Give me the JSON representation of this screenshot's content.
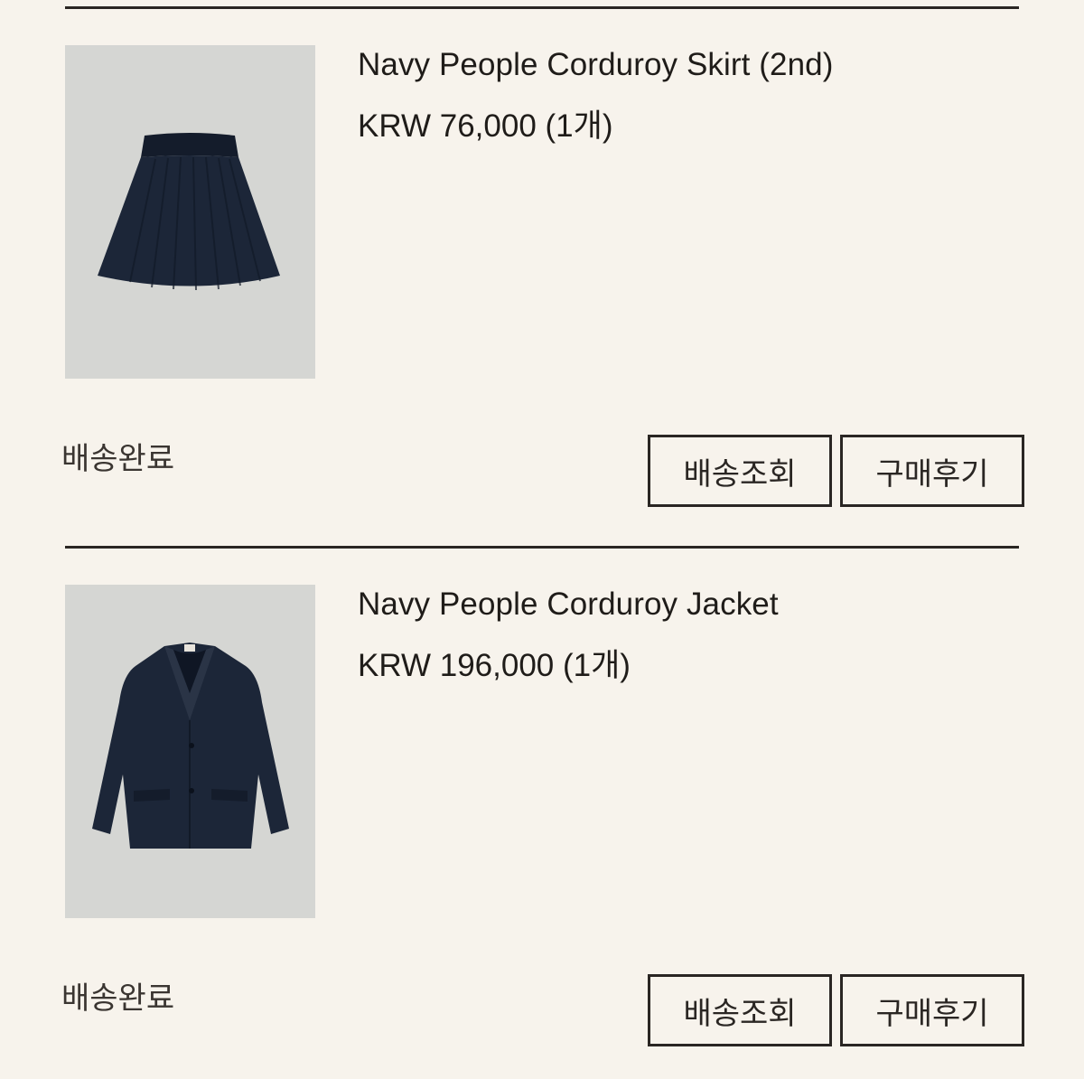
{
  "orders": [
    {
      "product_name": "Navy People Corduroy Skirt (2nd)",
      "price": "KRW 76,000 (1개)",
      "status": "배송완료",
      "track_label": "배송조회",
      "review_label": "구매후기",
      "image": "navy-corduroy-skirt"
    },
    {
      "product_name": "Navy People Corduroy Jacket",
      "price": "KRW 196,000 (1개)",
      "status": "배송완료",
      "track_label": "배송조회",
      "review_label": "구매후기",
      "image": "navy-corduroy-jacket"
    }
  ],
  "colors": {
    "background": "#f7f3ec",
    "text": "#1f1c19",
    "border": "#2a2623",
    "thumb_bg": "#d5d6d3",
    "garment": "#1c2638"
  }
}
